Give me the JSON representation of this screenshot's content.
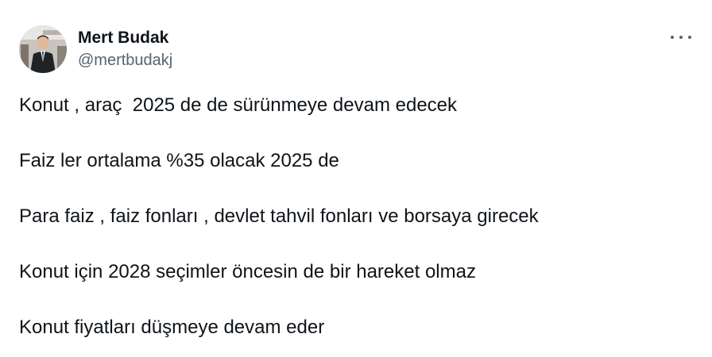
{
  "author": {
    "display_name": "Mert Budak",
    "handle": "@mertbudakj"
  },
  "tweet": {
    "lines": [
      "Konut , araç  2025 de de sürünmeye devam edecek",
      "Faiz ler ortalama %35 olacak 2025 de",
      "Para faiz , faiz fonları , devlet tahvil fonları ve borsaya girecek",
      "Konut için 2028 seçimler öncesin de bir hareket olmaz",
      "Konut fiyatları düşmeye devam eder"
    ]
  },
  "icons": {
    "more": "more-horizontal-icon"
  },
  "colors": {
    "text_primary": "#0f1419",
    "text_secondary": "#536471",
    "background": "#ffffff"
  }
}
